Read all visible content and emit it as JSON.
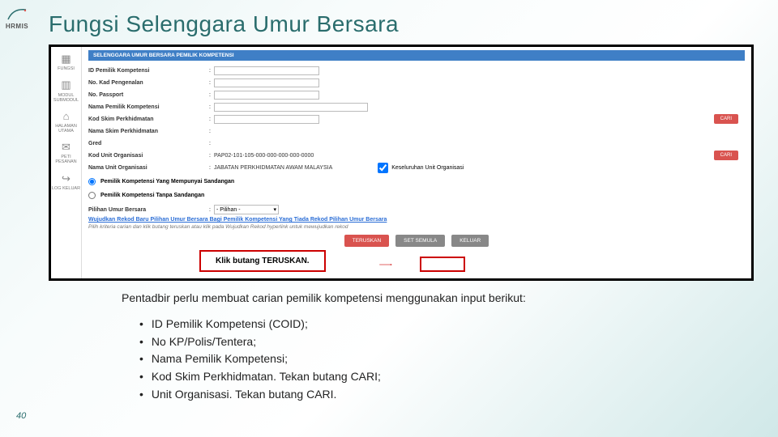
{
  "logo_text": "HRMIS",
  "title": "Fungsi Selenggara Umur Bersara",
  "app": {
    "sidebar": [
      {
        "icon": "▦",
        "label": "FUNGSI"
      },
      {
        "icon": "▥",
        "label": "MODUL SUBMODUL"
      },
      {
        "icon": "⌂",
        "label": "HALAMAN UTAMA"
      },
      {
        "icon": "✉",
        "label": "PETI PESANAN"
      },
      {
        "icon": "↪",
        "label": "LOG KELUAR"
      }
    ],
    "breadcrumb": "SELENGGARA UMUR BERSARA PEMILIK KOMPETENSI",
    "fields": {
      "id_label": "ID Pemilik Kompetensi",
      "nokp_label": "No. Kad Pengenalan",
      "passport_label": "No. Passport",
      "nama_label": "Nama Pemilik Kompetensi",
      "kodskim_label": "Kod Skim Perkhidmatan",
      "namaskim_label": "Nama Skim Perkhidmatan",
      "gred_label": "Gred",
      "kodunit_label": "Kod Unit Organisasi",
      "kodunit_value": "PAP02-101-105-000-000-000-000-0000",
      "namaunit_label": "Nama Unit Organisasi",
      "namaunit_value": "JABATAN PERKHIDMATAN AWAM MALAYSIA",
      "cari": "CARI",
      "chk_keseluruhan": "Keseluruhan Unit Organisasi",
      "radio1": "Pemilik Kompetensi Yang Mempunyai Sandangan",
      "radio2": "Pemilik Kompetensi Tanpa Sandangan",
      "pilihan_label": "Pilihan Umur Bersara",
      "pilihan_value": "- Pilihan -",
      "link": "Wujudkan Rekod Baru Pilihan Umur Bersara Bagi Pemilik Kompetensi Yang Tiada Rekod Pilihan Umur Bersara",
      "hint": "Pilih kriteria carian dan klik butang teruskan atau klik pada Wujudkan Rekod hyperlink untuk mewujudkan rekod",
      "btn_teruskan": "TERUSKAN",
      "btn_reset": "SET SEMULA",
      "btn_keluar": "KELUAR"
    },
    "callout_pre": "Klik butang ",
    "callout_bold": "TERUSKAN."
  },
  "caption": "Pentadbir perlu membuat carian pemilik kompetensi menggunakan input berikut:",
  "bullets": [
    "ID Pemilik Kompetensi (COID);",
    "No KP/Polis/Tentera;",
    "Nama Pemilik Kompetensi;",
    "Kod Skim Perkhidmatan. Tekan butang CARI;",
    "Unit Organisasi. Tekan butang CARI."
  ],
  "page_number": "40"
}
